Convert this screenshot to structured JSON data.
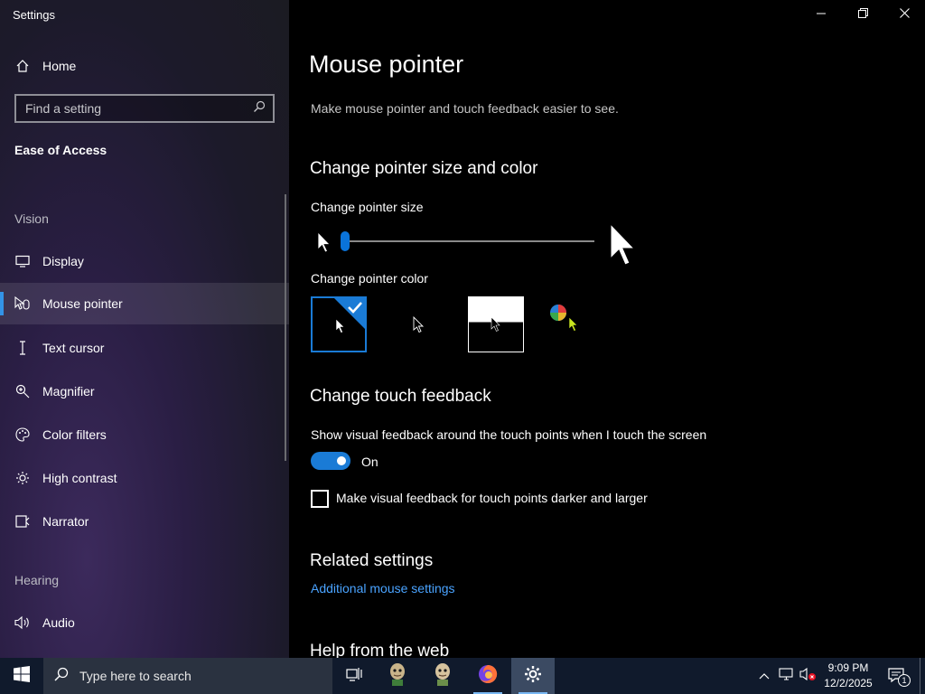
{
  "window": {
    "title": "Settings",
    "controls": {
      "minimize": "minimize-icon",
      "maximize": "restore-icon",
      "close": "close-icon"
    }
  },
  "sidebar": {
    "home_label": "Home",
    "search_placeholder": "Find a setting",
    "section_title": "Ease of Access",
    "groups": [
      {
        "label": "Vision"
      },
      {
        "label": "Hearing"
      }
    ],
    "items": [
      {
        "label": "Display",
        "icon": "display-icon"
      },
      {
        "label": "Mouse pointer",
        "icon": "mouse-pointer-icon",
        "selected": true
      },
      {
        "label": "Text cursor",
        "icon": "text-cursor-icon"
      },
      {
        "label": "Magnifier",
        "icon": "magnifier-icon"
      },
      {
        "label": "Color filters",
        "icon": "color-filters-icon"
      },
      {
        "label": "High contrast",
        "icon": "high-contrast-icon"
      },
      {
        "label": "Narrator",
        "icon": "narrator-icon"
      },
      {
        "label": "Audio",
        "icon": "audio-icon"
      }
    ],
    "accent_color": "#3393e6"
  },
  "main": {
    "title": "Mouse pointer",
    "description": "Make mouse pointer and touch feedback easier to see.",
    "size_color_heading": "Change pointer size and color",
    "pointer_size_label": "Change pointer size",
    "pointer_size_value": 0.0,
    "pointer_color_label": "Change pointer color",
    "pointer_color_options": [
      "white",
      "black",
      "inverted",
      "custom"
    ],
    "pointer_color_selected": "white",
    "touch_heading": "Change touch feedback",
    "touch_feedback_label": "Show visual feedback around the touch points when I touch the screen",
    "touch_toggle_state": "On",
    "darker_larger_label": "Make visual feedback for touch points darker and larger",
    "darker_larger_checked": false,
    "related_heading": "Related settings",
    "related_link": "Additional mouse settings",
    "help_heading": "Help from the web"
  },
  "taskbar": {
    "search_placeholder": "Type here to search",
    "apps": [
      "task-view-icon",
      "app-avatar-icon",
      "app-avatar-icon",
      "firefox-icon",
      "settings-gear-icon"
    ],
    "time": "9:09 PM",
    "date": "12/2/2025",
    "notification_count": "1",
    "colors": {
      "bar": "#101a2c",
      "active": "#3b4a62",
      "accent": "#1a7bd6"
    }
  }
}
